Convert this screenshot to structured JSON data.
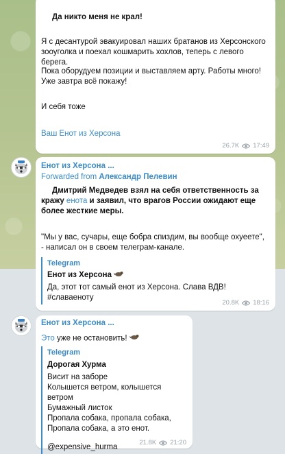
{
  "msg1": {
    "bold_line": "Да никто меня не крал!",
    "para1": "Я с десантурой эвакуировал наших братанов из Херсонского зооуголка и поехал кошмарить хохлов, теперь с левого берега.",
    "para2": "Пока оборудуем позиции и выставляем арту. Работы много! Уже завтра всё покажу!",
    "para3": "И себя тоже",
    "signature": "Ваш Енот из Херсона",
    "views": "26.7K",
    "time": "17:49"
  },
  "msg2": {
    "sender": "Енот из Херсона ...",
    "forward_label": "Forwarded from",
    "forward_from": "Александр Пелевин",
    "bold_a": "Дмитрий Медведев взял на себя ответственность за кражу ",
    "bold_link": "енота",
    "bold_b": " и заявил, что врагов России ожидают еще более жесткие меры.",
    "quote_text": "\"Мы у вас, сучары, еще бобра спиздим, вы вообще охуеете\", - написал он в своем телеграм-канале.",
    "preview": {
      "site": "Telegram",
      "title": "Енот из Херсона",
      "line1": "Да, этот тот самый енот из Херсона. Слава ВДВ!",
      "line2": "#славаеноту"
    },
    "views": "20.8K",
    "time": "18:16"
  },
  "msg3": {
    "sender": "Енот из Херсона ...",
    "text_link": "Это",
    "text_rest": " уже не остановить!",
    "preview": {
      "site": "Telegram",
      "title": "Дорогая Хурма",
      "lines": [
        "Висит на заборе",
        "Колышется ветром, колышется ветром",
        "Бумажный листок",
        "Пропала собака, пропала собака,",
        "Пропала собака, а это енот."
      ],
      "handle": "@expensive_hurma"
    },
    "views": "21.8K",
    "time": "21:20"
  },
  "icons": {
    "views": "eye-icon",
    "emoji": "raccoon-emoji-icon",
    "avatar": "channel-avatar"
  },
  "colors": {
    "link": "#3a8ccd",
    "meta": "#9aa3a9",
    "wallpaper": "#b6c592"
  }
}
